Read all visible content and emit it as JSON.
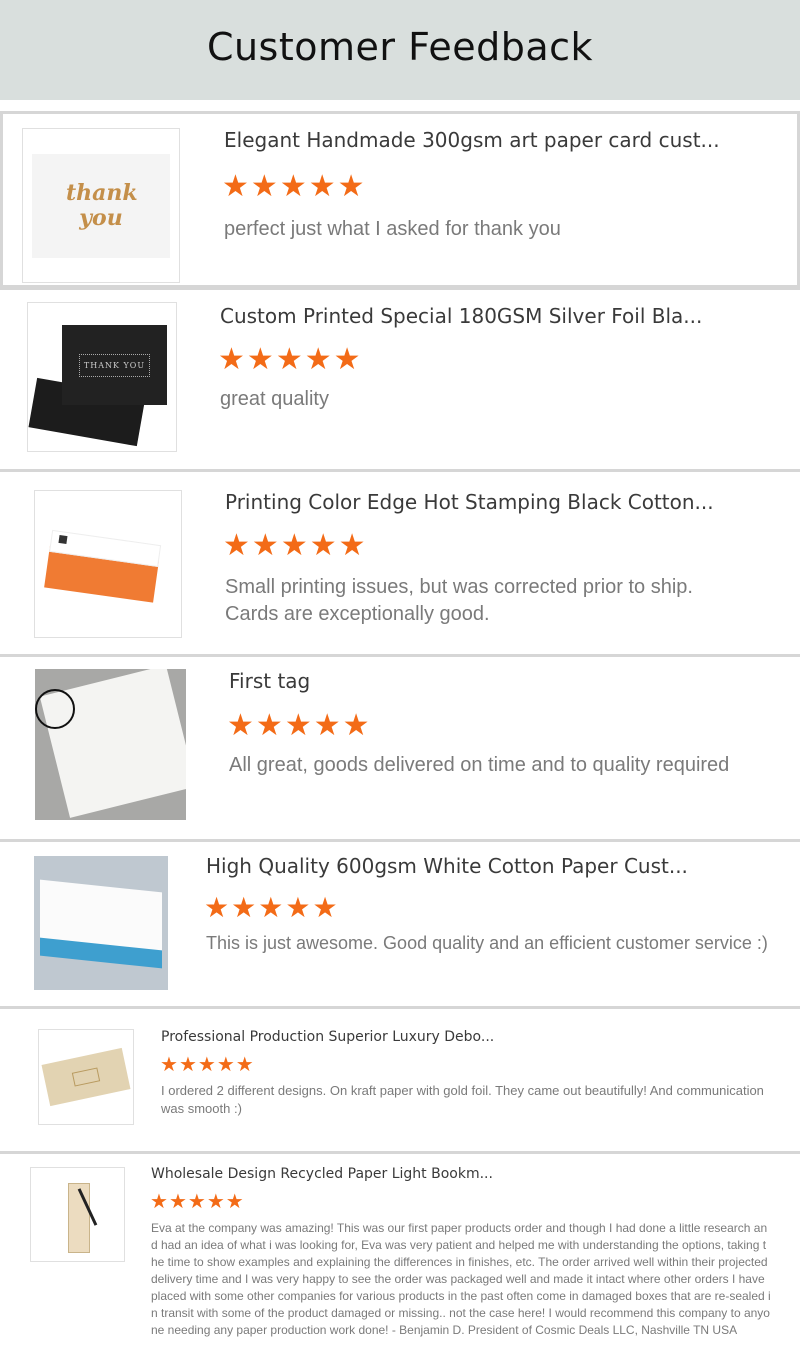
{
  "header": {
    "title": "Customer Feedback"
  },
  "colors": {
    "star": "#f36b17",
    "header_bg": "#d9dfdd"
  },
  "reviews": [
    {
      "title": "Elegant Handmade 300gsm art paper card cust...",
      "rating": 5,
      "text": "perfect just what I asked for thank you",
      "thumb_text": "thank you"
    },
    {
      "title": "Custom Printed Special 180GSM Silver Foil Bla...",
      "rating": 5,
      "text": "great quality",
      "thumb_text": "THANK YOU"
    },
    {
      "title": "Printing Color Edge Hot Stamping Black Cotton...",
      "rating": 5,
      "text": "Small printing issues, but was corrected prior to ship. Cards are exceptionally good."
    },
    {
      "title": "First tag",
      "rating": 5,
      "text": "All great, goods delivered on time and to quality required"
    },
    {
      "title": "High Quality 600gsm White Cotton Paper Cust...",
      "rating": 5,
      "text": "This is just awesome. Good quality and an efficient customer service :)"
    },
    {
      "title": "Professional Production Superior Luxury Debo...",
      "rating": 5,
      "text": "I ordered 2 different designs. On kraft paper with gold foil. They came out beautifully! And communication was smooth :)"
    },
    {
      "title": "Wholesale Design Recycled Paper Light Bookm...",
      "rating": 5,
      "text": "Eva at the company was amazing!   This was our first paper products order and though I had done a little research and had an idea of what i was looking for, Eva was very patient and helped me with understanding the options, taking the time to show examples and explaining the differences in finishes, etc.   The order arrived well within their projected delivery time and I was very happy to see the order was packaged well and made it intact where other orders I have placed with some other companies for various products in the past often come in damaged boxes that are re-sealed in transit with some of the product damaged or missing.. not the case here!   I would recommend this company to anyone needing any paper production work done!   - Benjamin D.  President of Cosmic Deals LLC, Nashville TN USA"
    }
  ]
}
